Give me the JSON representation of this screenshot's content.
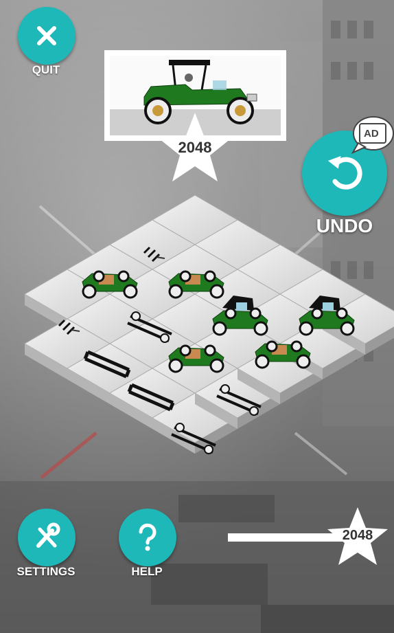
{
  "top": {
    "quit_label": "QUIT",
    "target_value": "2048"
  },
  "right": {
    "undo_label": "UNDO",
    "ad_label": "AD"
  },
  "bottom": {
    "settings_label": "SETTINGS",
    "help_label": "HELP",
    "best_value": "2048",
    "progress_fraction": 0.85
  },
  "board": {
    "rows": 4,
    "cols": 4,
    "tiles": [
      [
        "empty",
        "empty",
        "empty",
        "empty"
      ],
      [
        "parts",
        "empty",
        "empty",
        "empty"
      ],
      [
        "car-open",
        "car-open",
        "empty",
        "empty"
      ],
      [
        "parts",
        "chassis-axle",
        "car-hood",
        "car-hood"
      ],
      [
        "chassis",
        "car-open",
        "car-open",
        "empty"
      ],
      [
        "chassis",
        "chassis-axle",
        "empty",
        "empty"
      ],
      [
        "chassis-axle",
        "empty",
        "empty",
        "empty"
      ]
    ]
  },
  "colors": {
    "accent": "#1fb8b9",
    "tile_top": "#e6e6e6",
    "car_green": "#1f7a1f"
  },
  "icons": {
    "quit": "close-icon",
    "undo": "undo-icon",
    "ad": "film-icon",
    "settings": "wrench-screwdriver-icon",
    "help": "question-icon",
    "star": "star-icon"
  }
}
